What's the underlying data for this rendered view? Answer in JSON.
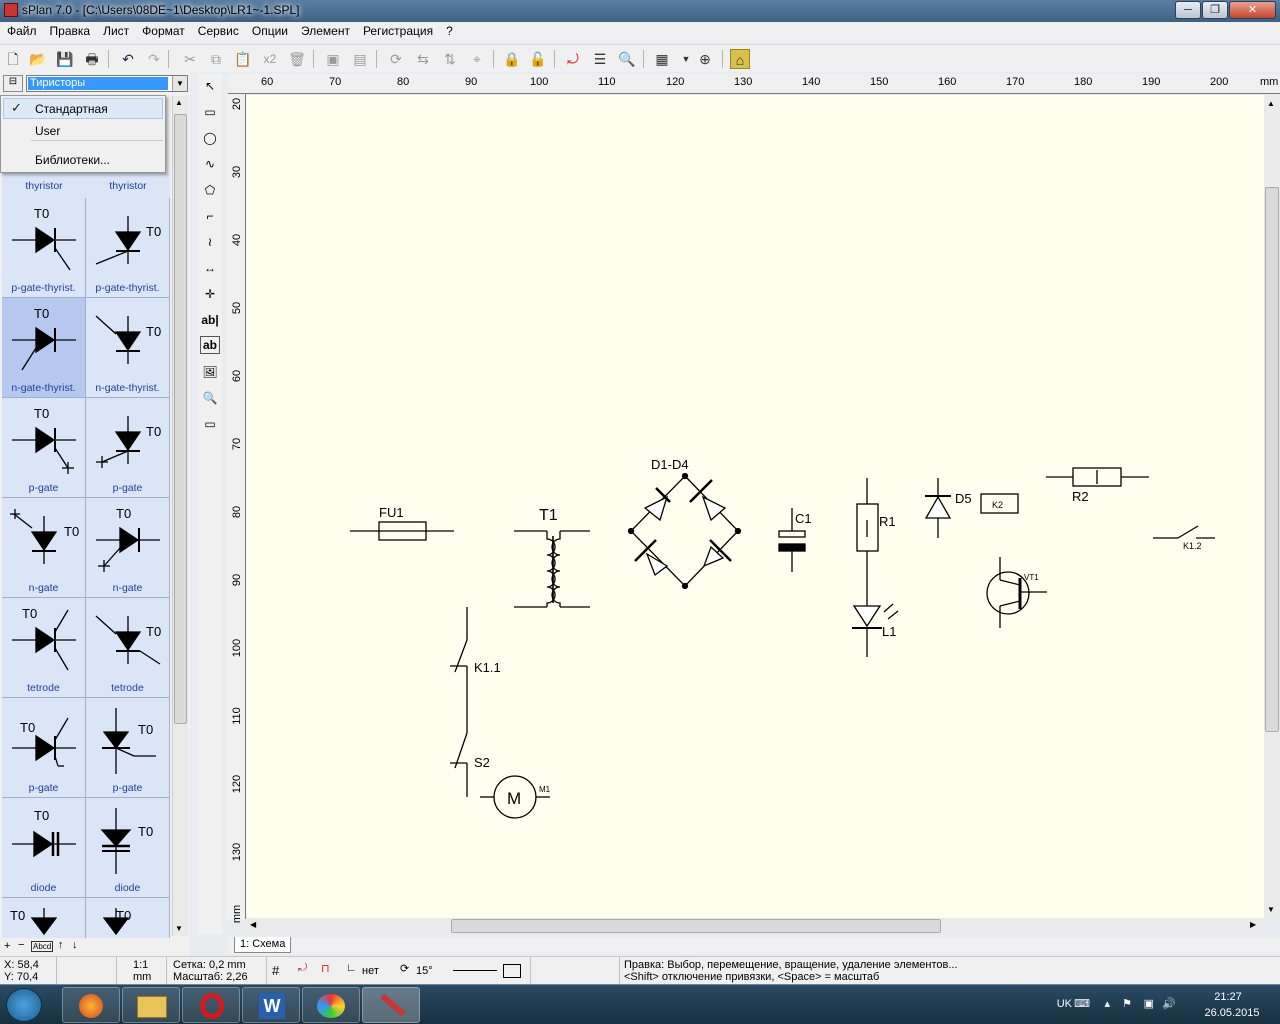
{
  "window": {
    "title": "sPlan 7.0 - [C:\\Users\\08DE~1\\Desktop\\LR1~-1.SPL]"
  },
  "menu": [
    "Файл",
    "Правка",
    "Лист",
    "Формат",
    "Сервис",
    "Опции",
    "Элемент",
    "Регистрация",
    "?"
  ],
  "toolbar": {
    "zoom_label": "x2"
  },
  "library": {
    "combo_value": "Тиристоры",
    "popup": {
      "items": [
        "Стандартная",
        "User",
        "Библиотеки..."
      ]
    },
    "header_labels": [
      "thyristor",
      "thyristor"
    ],
    "cells": [
      {
        "tz": "T0",
        "label": "p-gate-thyrist."
      },
      {
        "tz": "T0",
        "label": "p-gate-thyrist."
      },
      {
        "tz": "T0",
        "label": "n-gate-thyrist."
      },
      {
        "tz": "T0",
        "label": "n-gate-thyrist."
      },
      {
        "tz": "T0",
        "label": "p-gate"
      },
      {
        "tz": "T0",
        "label": "p-gate"
      },
      {
        "tz": "T0",
        "label": "n-gate"
      },
      {
        "tz": "T0",
        "label": "n-gate"
      },
      {
        "tz": "T0",
        "label": "tetrode"
      },
      {
        "tz": "T0",
        "label": "tetrode"
      },
      {
        "tz": "T0",
        "label": "p-gate"
      },
      {
        "tz": "T0",
        "label": "p-gate"
      },
      {
        "tz": "T0",
        "label": "diode"
      },
      {
        "tz": "T0",
        "label": "diode"
      },
      {
        "tz": "T0",
        "label": ""
      },
      {
        "tz": "T0",
        "label": ""
      }
    ],
    "selected_index": 2,
    "bottom_label": "Abcd"
  },
  "drawtools": {
    "text_tool": "ab|",
    "text_box": "ab"
  },
  "rulers": {
    "top": [
      "60",
      "70",
      "80",
      "90",
      "100",
      "110",
      "120",
      "130",
      "140",
      "150",
      "160",
      "170",
      "180",
      "190",
      "200",
      "mm"
    ],
    "left": [
      "20",
      "30",
      "40",
      "50",
      "60",
      "70",
      "80",
      "90",
      "100",
      "110",
      "120",
      "130",
      "mm"
    ]
  },
  "schematic": {
    "labels": {
      "fu1": "FU1",
      "t1": "T1",
      "d1d4": "D1-D4",
      "c1": "C1",
      "r1": "R1",
      "l1": "L1",
      "d5": "D5",
      "k2": "K2",
      "r2": "R2",
      "k12": "K1.2",
      "vt1": "VT1",
      "k11": "K1.1",
      "s2": "S2",
      "m1": "M1",
      "m_letter": "M"
    }
  },
  "tabs": [
    "1: Схема"
  ],
  "status": {
    "x": "X: 58,4",
    "y": "Y: 70,4",
    "scale_a": "1:1",
    "scale_b": "mm",
    "grid": "Сетка: 0,2 mm",
    "zoom": "Масштаб:  2,26",
    "ortho": "нет",
    "angle": "15°",
    "hint1": "Правка: Выбор, перемещение, вращение, удаление элементов...",
    "hint2": "<Shift> отключение привязки, <Space> = масштаб"
  },
  "taskbar": {
    "lang": "UK",
    "time": "21:27",
    "date": "26.05.2015"
  }
}
